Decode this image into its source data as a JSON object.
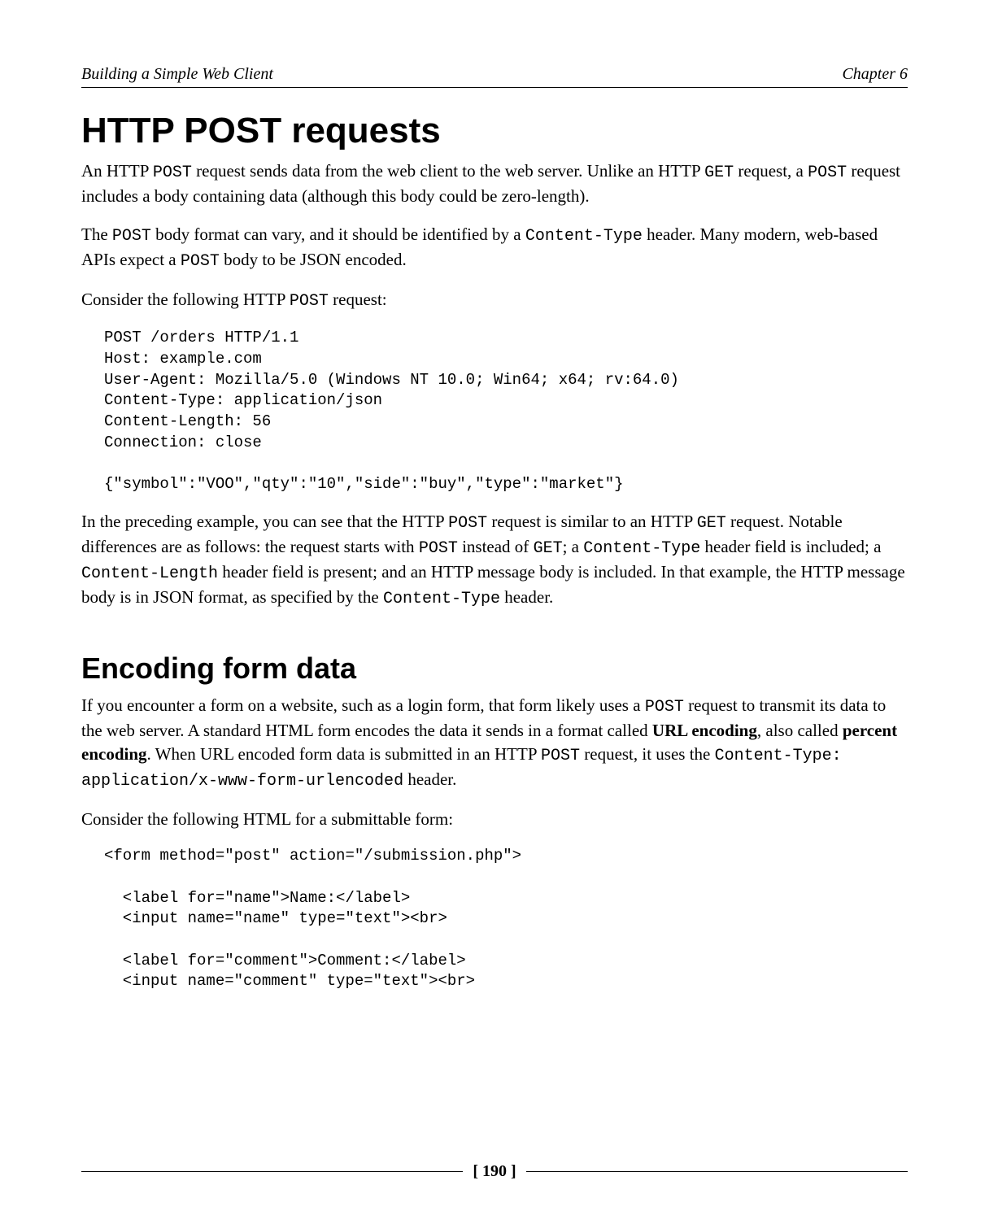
{
  "header": {
    "left": "Building a Simple Web Client",
    "right": "Chapter 6"
  },
  "section1": {
    "heading": "HTTP POST requests",
    "p1_a": "An HTTP ",
    "p1_code1": "POST",
    "p1_b": " request sends data from the web client to the web server. Unlike an HTTP ",
    "p1_code2": "GET",
    "p1_c": " request, a ",
    "p1_code3": "POST",
    "p1_d": " request includes a body containing data (although this body could be zero-length).",
    "p2_a": "The ",
    "p2_code1": "POST",
    "p2_b": " body format can vary, and it should be identified by a ",
    "p2_code2": "Content-Type",
    "p2_c": " header. Many modern, web-based APIs expect a ",
    "p2_code3": "POST",
    "p2_d": " body to be JSON encoded.",
    "p3_a": "Consider the following HTTP ",
    "p3_code1": "POST",
    "p3_b": " request:",
    "code1": "POST /orders HTTP/1.1\nHost: example.com\nUser-Agent: Mozilla/5.0 (Windows NT 10.0; Win64; x64; rv:64.0)\nContent-Type: application/json\nContent-Length: 56\nConnection: close\n\n{\"symbol\":\"VOO\",\"qty\":\"10\",\"side\":\"buy\",\"type\":\"market\"}",
    "p4_a": "In the preceding example, you can see that the HTTP ",
    "p4_code1": "POST",
    "p4_b": " request is similar to an HTTP ",
    "p4_code2": "GET",
    "p4_c": " request. Notable differences are as follows: the request starts with ",
    "p4_code3": "POST",
    "p4_d": " instead of ",
    "p4_code4": "GET",
    "p4_e": "; a ",
    "p4_code5": "Content-Type",
    "p4_f": " header field is included; a ",
    "p4_code6": "Content-Length",
    "p4_g": " header field is present; and an HTTP message body is included. In that example, the HTTP message body is in JSON format, as specified by the ",
    "p4_code7": "Content-Type",
    "p4_h": " header."
  },
  "section2": {
    "heading": "Encoding form data",
    "p1_a": "If you encounter a form on a website, such as a login form, that form likely uses a ",
    "p1_code1": "POST",
    "p1_b": " request to transmit its data to the web server. A standard HTML form encodes the data it sends in a format called ",
    "p1_bold1": "URL encoding",
    "p1_c": ", also called ",
    "p1_bold2": "percent encoding",
    "p1_d": ". When URL encoded form data is submitted in an HTTP ",
    "p1_code2": "POST",
    "p1_e": " request, it uses the ",
    "p1_code3": "Content-Type: application/x-www-form-urlencoded",
    "p1_f": " header.",
    "p2": "Consider the following HTML for a submittable form:",
    "code1": "<form method=\"post\" action=\"/submission.php\">\n\n  <label for=\"name\">Name:</label>\n  <input name=\"name\" type=\"text\"><br>\n\n  <label for=\"comment\">Comment:</label>\n  <input name=\"comment\" type=\"text\"><br>"
  },
  "footer": {
    "page_number": "[ 190 ]"
  }
}
